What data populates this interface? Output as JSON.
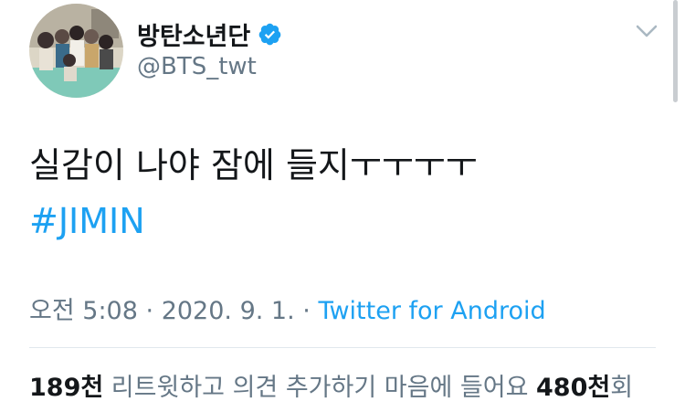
{
  "header": {
    "display_name": "방탄소년단",
    "handle": "@BTS_twt",
    "verified": true,
    "icons": [
      "avatar",
      "verified-badge-icon",
      "chevron-down-icon"
    ]
  },
  "tweet": {
    "text": "실감이 나야 잠에 들지ㅜㅜㅜㅜ",
    "hashtag": "#JIMIN"
  },
  "meta": {
    "time": "오전 5:08",
    "separator": "·",
    "date": "2020. 9. 1.",
    "source": "Twitter for Android"
  },
  "stats": {
    "retweets_count": "189천",
    "retweets_label": "리트윗하고 의견 추가하기",
    "likes_label": "마음에 들어요",
    "likes_count": "480천",
    "likes_suffix": "회"
  },
  "colors": {
    "link": "#1da1f2",
    "secondary_text": "#657786",
    "primary_text": "#14171a",
    "divider": "#e1e8ed"
  }
}
